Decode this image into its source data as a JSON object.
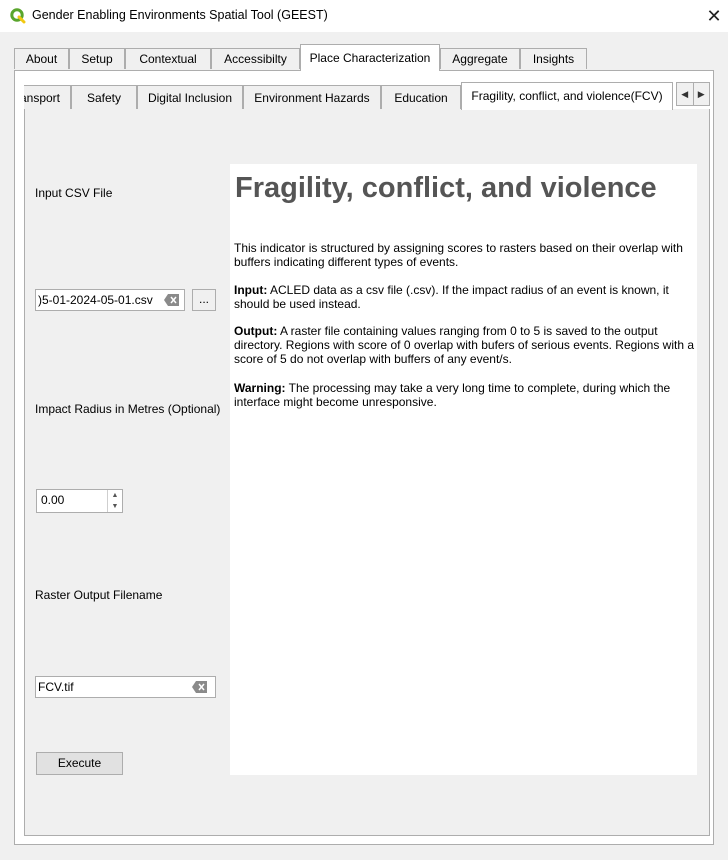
{
  "window": {
    "title": "Gender Enabling Environments Spatial Tool (GEEST)",
    "close": "✕"
  },
  "main_tabs": [
    "About",
    "Setup",
    "Contextual",
    "Accessibilty",
    "Place Characterization",
    "Aggregate",
    "Insights"
  ],
  "main_tabs_active": "Place Characterization",
  "sub_tabs": [
    "ansport",
    "Safety",
    "Digital Inclusion",
    "Environment Hazards",
    "Education",
    "Fragility, conflict, and violence(FCV)"
  ],
  "sub_tabs_active": "Fragility, conflict, and violence(FCV)",
  "form": {
    "csv_label": "Input CSV File",
    "csv_value": ")5-01-2024-05-01.csv",
    "browse_label": "...",
    "radius_label": "Impact Radius in Metres (Optional)",
    "radius_value": "0.00",
    "output_label": "Raster Output Filename",
    "output_value": "FCV.tif",
    "execute_label": "Execute"
  },
  "help": {
    "heading": "Fragility, conflict, and violence",
    "intro": "This indicator is structured by assigning scores to rasters based on their overlap with buffers indicating different types of events.",
    "input_label": "Input:",
    "input_text": " ACLED data as a csv file (.csv). If the impact radius of an event is known, it should be used instead.",
    "output_label": "Output:",
    "output_text": " A raster file containing values ranging from 0 to 5 is saved to the output directory. Regions with score of 0 overlap with bufers of serious events. Regions with a score of 5 do not overlap with buffers of any event/s.",
    "warning_label": "Warning:",
    "warning_text": " The processing may take a very long time to complete, during which the interface might become unresponsive."
  },
  "colors": {
    "accent_icon": "#59a52c",
    "heading": "#555555",
    "border": "#adadad"
  }
}
